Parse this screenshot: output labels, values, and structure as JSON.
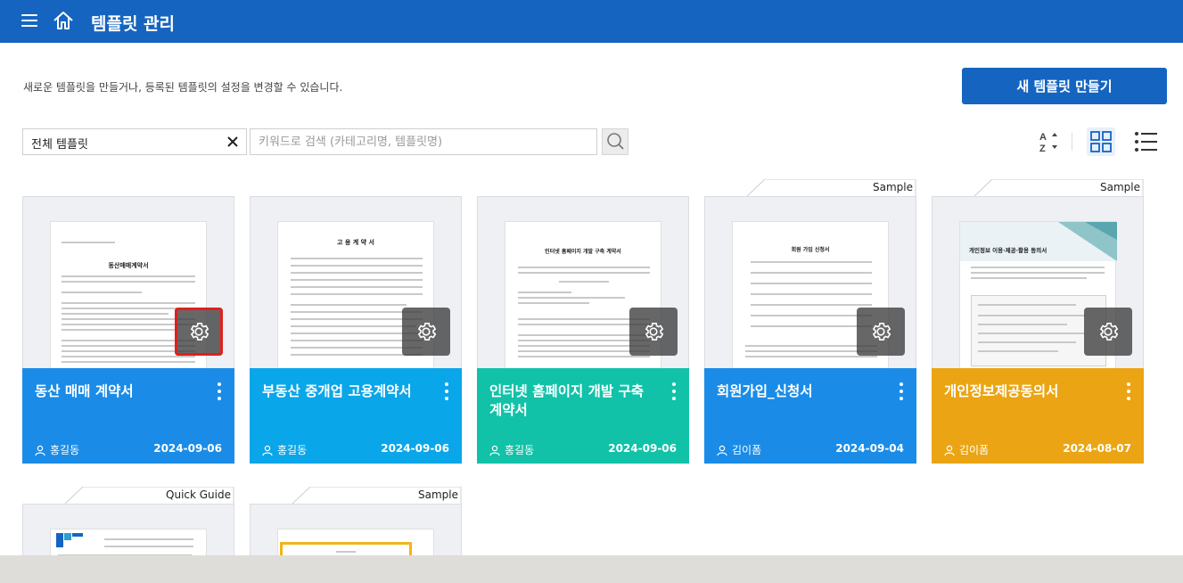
{
  "header": {
    "title": "템플릿 관리",
    "menu_icon": "hamburger-menu-icon",
    "home_icon": "home-icon",
    "bg": "#1565c0"
  },
  "toolbar": {
    "description": "새로운 템플릿을 만들거나, 등록된 템플릿의 설정을 변경할 수 있습니다.",
    "new_button": "새 템플릿 만들기",
    "filter_value": "전체 템플릿",
    "search_placeholder": "키워드로 검색 (카테고리명, 템플릿명)"
  },
  "cards": [
    {
      "name": "동산 매매 계약서",
      "user": "홍길동",
      "date": "2024-09-06",
      "color": "#1a8ce8",
      "tag": "",
      "doc_title": "동산매매계약서",
      "selected_gear": true
    },
    {
      "name": "부동산 중개업 고용계약서",
      "user": "홍길동",
      "date": "2024-09-06",
      "color": "#0aa6ea",
      "tag": "",
      "doc_title": "고 용 계 약 서"
    },
    {
      "name": "인터넷 홈페이지 개발 구축 계약서",
      "user": "홍길동",
      "date": "2024-09-06",
      "color": "#11c2a8",
      "tag": "",
      "doc_title": "인터넷 홈페이지 개발 구축 계약서"
    },
    {
      "name": "회원가입_신청서",
      "user": "김이폼",
      "date": "2024-09-04",
      "color": "#1a8ce8",
      "tag": "Sample",
      "doc_title": "회원 가입 신청서"
    },
    {
      "name": "개인정보제공동의서",
      "user": "김이폼",
      "date": "2024-08-07",
      "color": "#eba514",
      "tag": "Sample",
      "doc_title": "개인정보 이용·제공·활용 동의서"
    }
  ],
  "row2": [
    {
      "tag": "Quick Guide"
    },
    {
      "tag": "Sample"
    }
  ]
}
